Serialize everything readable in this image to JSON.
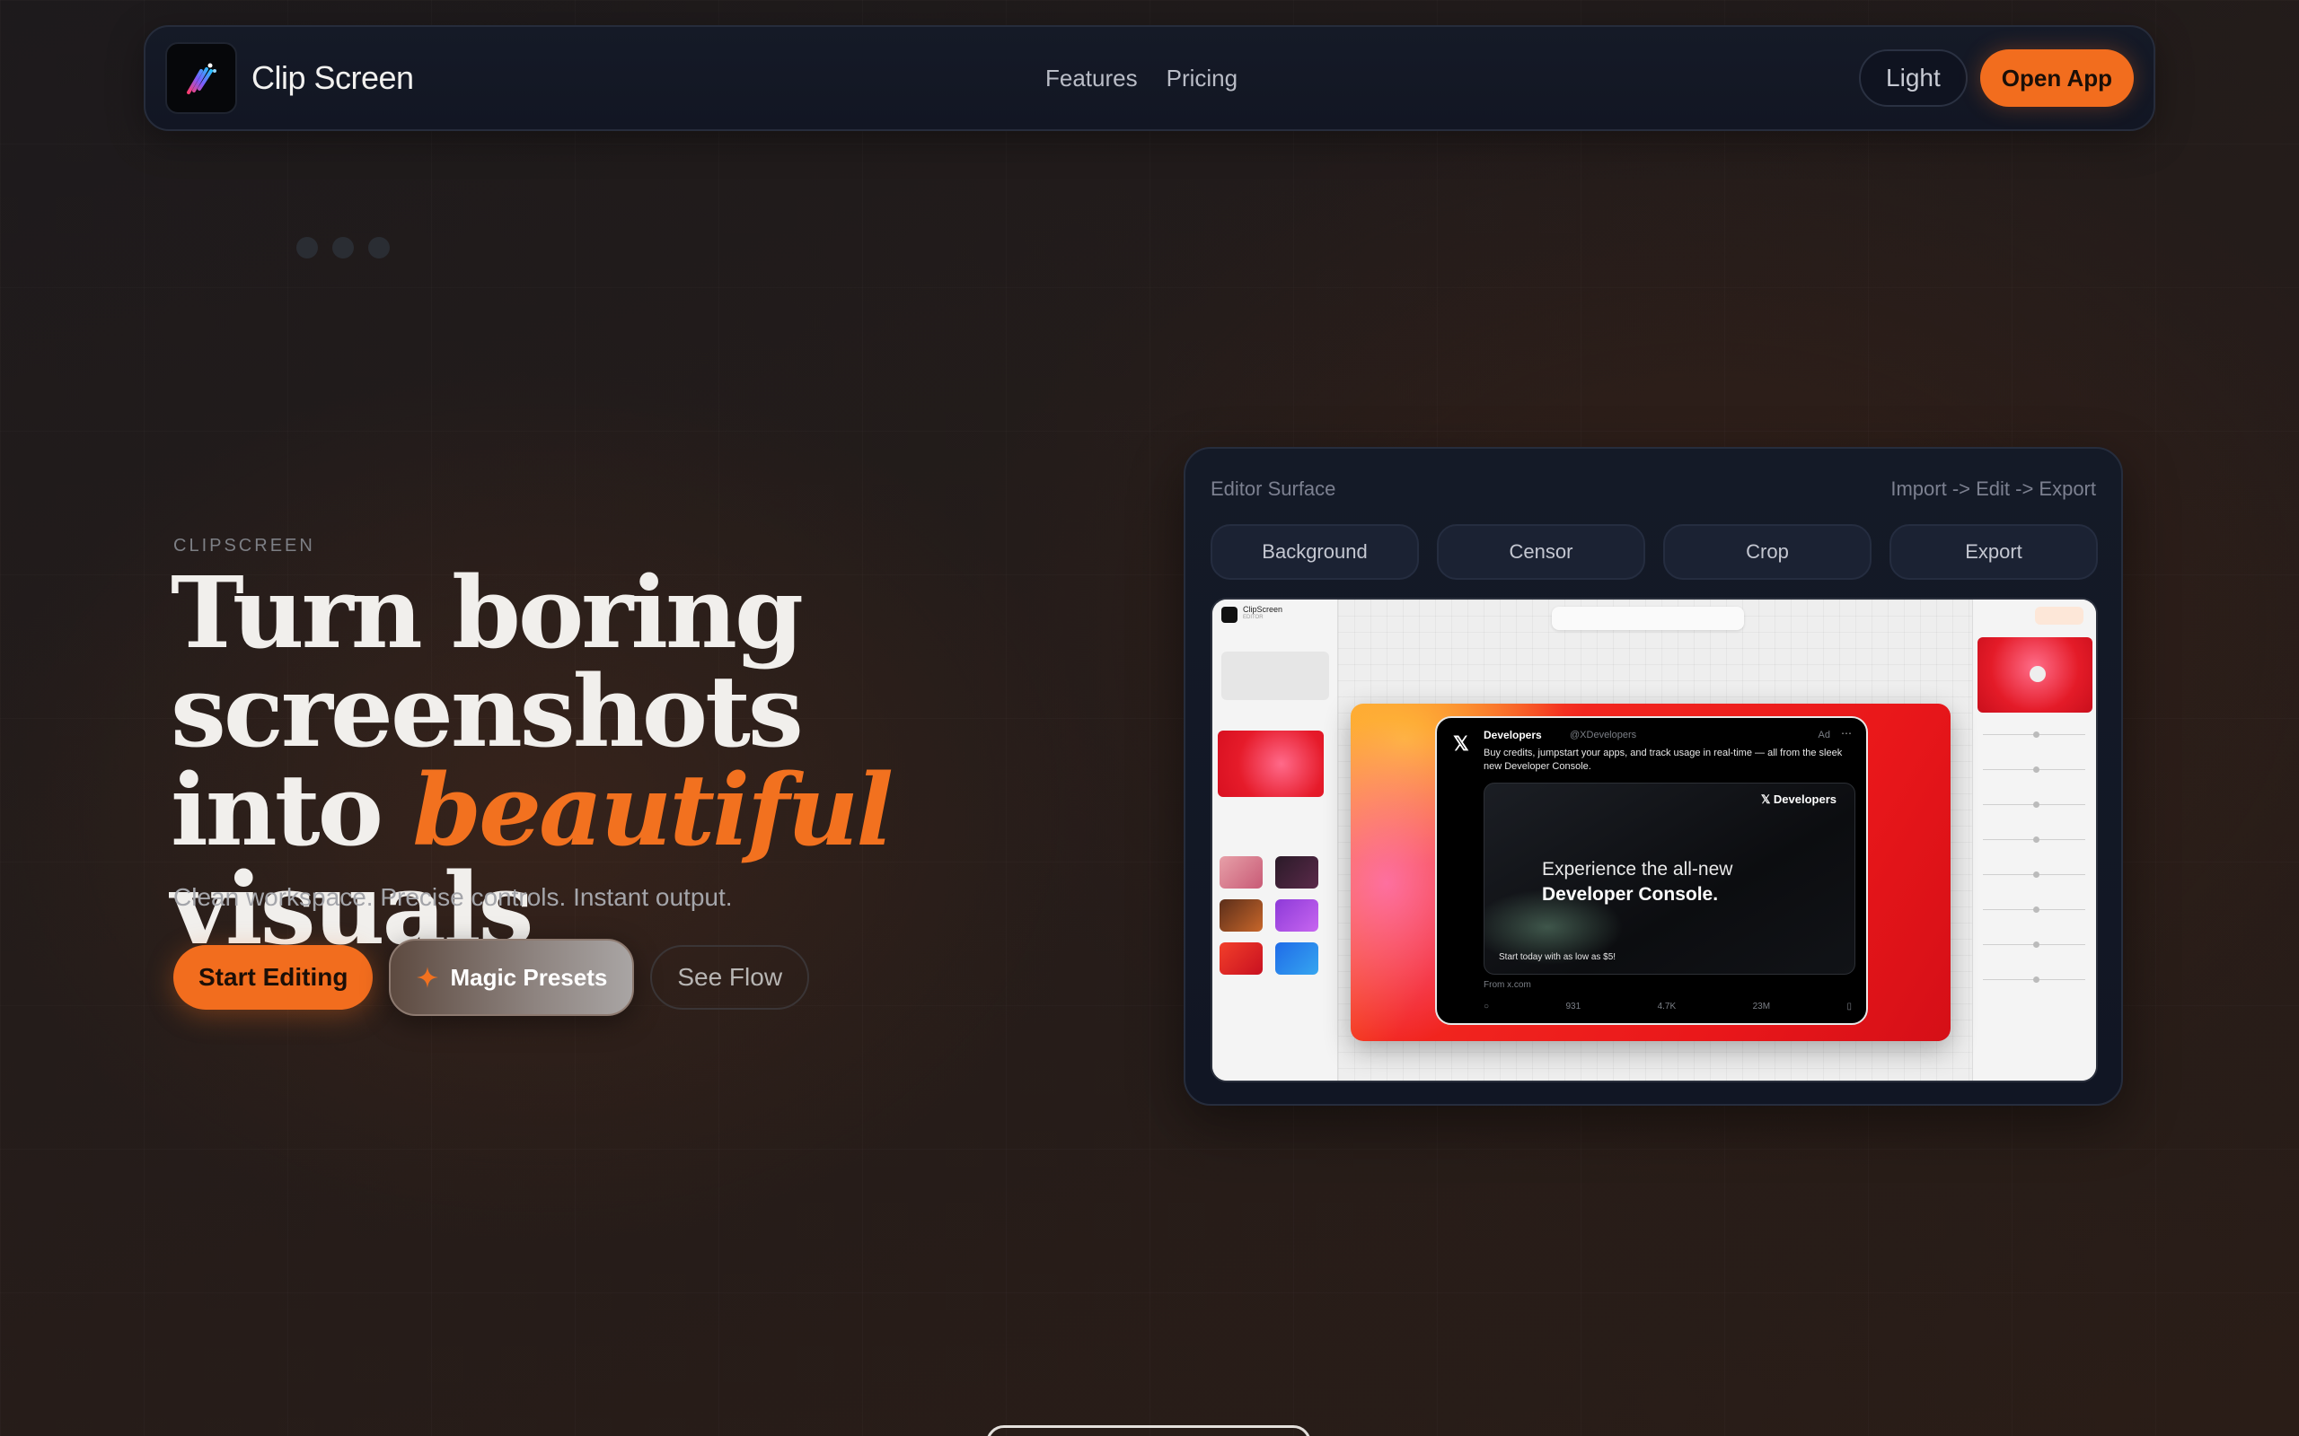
{
  "nav": {
    "brand": "Clip Screen",
    "links": [
      "Features",
      "Pricing"
    ],
    "theme_toggle": "Light",
    "open_app": "Open App"
  },
  "hero": {
    "eyebrow": "CLIPSCREEN",
    "headline_line1": "Turn boring",
    "headline_line2": "screenshots",
    "headline_line3_pre": "into ",
    "headline_accent": "beautiful",
    "headline_line3_post": " visuals",
    "subtitle": "Clean workspace. Precise controls. Instant output.",
    "cta_primary": "Start Editing",
    "cta_magic": "Magic Presets",
    "cta_flow": "See Flow"
  },
  "editor": {
    "title": "Editor Surface",
    "flow": "Import -> Edit -> Export",
    "tabs": [
      "Background",
      "Censor",
      "Crop",
      "Export"
    ],
    "preview": {
      "app_name": "ClipScreen",
      "app_sub": "EDITOR",
      "tweet": {
        "name": "Developers",
        "handle": "@XDevelopers",
        "ad": "Ad",
        "text": "Buy credits, jumpstart your apps, and track usage in real-time — all from the sleek new Developer Console.",
        "card_brand": "𝕏 Developers",
        "card_line1": "Experience the all-new",
        "card_line2": "Developer Console.",
        "card_note": "Start today with as low as $5!",
        "from": "From x.com",
        "stats": [
          "931",
          "4.7K",
          "23M"
        ]
      }
    }
  },
  "colors": {
    "accent": "#f26d1e",
    "nav_bg": "#131826",
    "panel_bg": "#131826"
  }
}
